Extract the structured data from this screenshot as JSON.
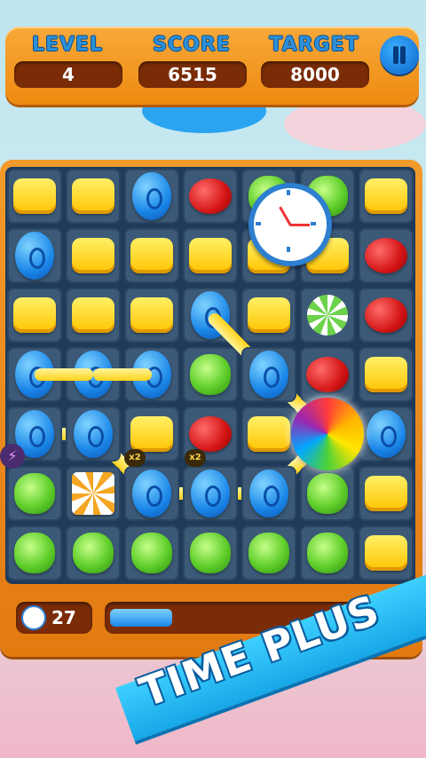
{
  "hud": {
    "level_label": "LEVEL",
    "level_value": "4",
    "score_label": "SCORE",
    "score_value": "6515",
    "target_label": "TARGET",
    "target_value": "8000"
  },
  "board": {
    "rows": [
      [
        "yellow",
        "yellow",
        "blue",
        "red",
        "green",
        "green",
        "yellow"
      ],
      [
        "blue",
        "yellow",
        "yellow",
        "yellow",
        "yellow",
        "yellow",
        "red"
      ],
      [
        "yellow",
        "yellow",
        "yellow",
        "blue",
        "yellow",
        "mint",
        "red"
      ],
      [
        "blue",
        "blue",
        "blue",
        "green",
        "blue",
        "red",
        "yellow"
      ],
      [
        "blue",
        "blue",
        "yellow",
        "red",
        "yellow",
        "rainbow",
        "blue"
      ],
      [
        "green",
        "stripe",
        "blue",
        "blue",
        "blue",
        "green",
        "yellow"
      ],
      [
        "green",
        "green",
        "green",
        "green",
        "green",
        "green",
        "yellow"
      ]
    ],
    "multiplier_labels": [
      "x2",
      "x2"
    ]
  },
  "timer": {
    "value": "27"
  },
  "progress": {
    "fraction": 0.2
  },
  "banner": {
    "text": "TIME PLUS"
  },
  "colors": {
    "accent_orange": "#ee8a10",
    "board_bg": "#1f3a5a",
    "banner_blue": "#17a7e8"
  }
}
